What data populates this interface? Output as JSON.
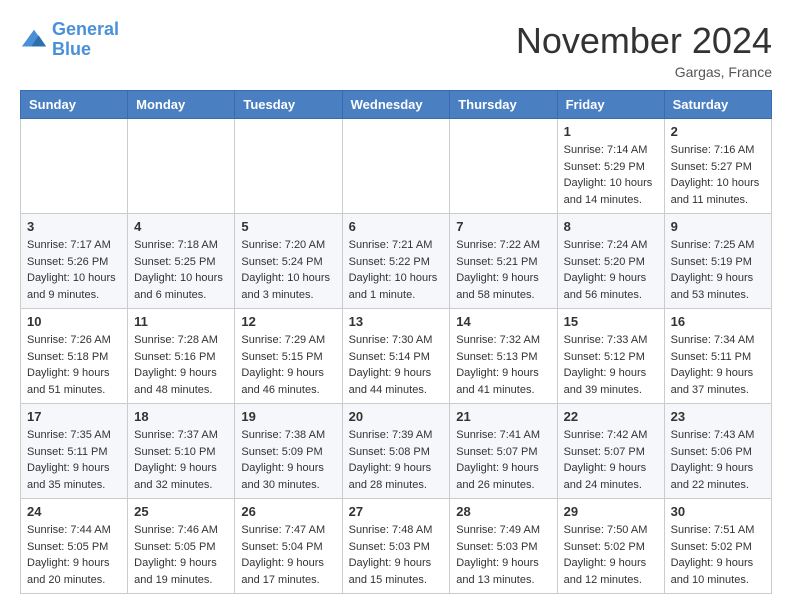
{
  "header": {
    "logo_line1": "General",
    "logo_line2": "Blue",
    "month": "November 2024",
    "location": "Gargas, France"
  },
  "weekdays": [
    "Sunday",
    "Monday",
    "Tuesday",
    "Wednesday",
    "Thursday",
    "Friday",
    "Saturday"
  ],
  "weeks": [
    [
      {
        "day": "",
        "info": ""
      },
      {
        "day": "",
        "info": ""
      },
      {
        "day": "",
        "info": ""
      },
      {
        "day": "",
        "info": ""
      },
      {
        "day": "",
        "info": ""
      },
      {
        "day": "1",
        "info": "Sunrise: 7:14 AM\nSunset: 5:29 PM\nDaylight: 10 hours and 14 minutes."
      },
      {
        "day": "2",
        "info": "Sunrise: 7:16 AM\nSunset: 5:27 PM\nDaylight: 10 hours and 11 minutes."
      }
    ],
    [
      {
        "day": "3",
        "info": "Sunrise: 7:17 AM\nSunset: 5:26 PM\nDaylight: 10 hours and 9 minutes."
      },
      {
        "day": "4",
        "info": "Sunrise: 7:18 AM\nSunset: 5:25 PM\nDaylight: 10 hours and 6 minutes."
      },
      {
        "day": "5",
        "info": "Sunrise: 7:20 AM\nSunset: 5:24 PM\nDaylight: 10 hours and 3 minutes."
      },
      {
        "day": "6",
        "info": "Sunrise: 7:21 AM\nSunset: 5:22 PM\nDaylight: 10 hours and 1 minute."
      },
      {
        "day": "7",
        "info": "Sunrise: 7:22 AM\nSunset: 5:21 PM\nDaylight: 9 hours and 58 minutes."
      },
      {
        "day": "8",
        "info": "Sunrise: 7:24 AM\nSunset: 5:20 PM\nDaylight: 9 hours and 56 minutes."
      },
      {
        "day": "9",
        "info": "Sunrise: 7:25 AM\nSunset: 5:19 PM\nDaylight: 9 hours and 53 minutes."
      }
    ],
    [
      {
        "day": "10",
        "info": "Sunrise: 7:26 AM\nSunset: 5:18 PM\nDaylight: 9 hours and 51 minutes."
      },
      {
        "day": "11",
        "info": "Sunrise: 7:28 AM\nSunset: 5:16 PM\nDaylight: 9 hours and 48 minutes."
      },
      {
        "day": "12",
        "info": "Sunrise: 7:29 AM\nSunset: 5:15 PM\nDaylight: 9 hours and 46 minutes."
      },
      {
        "day": "13",
        "info": "Sunrise: 7:30 AM\nSunset: 5:14 PM\nDaylight: 9 hours and 44 minutes."
      },
      {
        "day": "14",
        "info": "Sunrise: 7:32 AM\nSunset: 5:13 PM\nDaylight: 9 hours and 41 minutes."
      },
      {
        "day": "15",
        "info": "Sunrise: 7:33 AM\nSunset: 5:12 PM\nDaylight: 9 hours and 39 minutes."
      },
      {
        "day": "16",
        "info": "Sunrise: 7:34 AM\nSunset: 5:11 PM\nDaylight: 9 hours and 37 minutes."
      }
    ],
    [
      {
        "day": "17",
        "info": "Sunrise: 7:35 AM\nSunset: 5:11 PM\nDaylight: 9 hours and 35 minutes."
      },
      {
        "day": "18",
        "info": "Sunrise: 7:37 AM\nSunset: 5:10 PM\nDaylight: 9 hours and 32 minutes."
      },
      {
        "day": "19",
        "info": "Sunrise: 7:38 AM\nSunset: 5:09 PM\nDaylight: 9 hours and 30 minutes."
      },
      {
        "day": "20",
        "info": "Sunrise: 7:39 AM\nSunset: 5:08 PM\nDaylight: 9 hours and 28 minutes."
      },
      {
        "day": "21",
        "info": "Sunrise: 7:41 AM\nSunset: 5:07 PM\nDaylight: 9 hours and 26 minutes."
      },
      {
        "day": "22",
        "info": "Sunrise: 7:42 AM\nSunset: 5:07 PM\nDaylight: 9 hours and 24 minutes."
      },
      {
        "day": "23",
        "info": "Sunrise: 7:43 AM\nSunset: 5:06 PM\nDaylight: 9 hours and 22 minutes."
      }
    ],
    [
      {
        "day": "24",
        "info": "Sunrise: 7:44 AM\nSunset: 5:05 PM\nDaylight: 9 hours and 20 minutes."
      },
      {
        "day": "25",
        "info": "Sunrise: 7:46 AM\nSunset: 5:05 PM\nDaylight: 9 hours and 19 minutes."
      },
      {
        "day": "26",
        "info": "Sunrise: 7:47 AM\nSunset: 5:04 PM\nDaylight: 9 hours and 17 minutes."
      },
      {
        "day": "27",
        "info": "Sunrise: 7:48 AM\nSunset: 5:03 PM\nDaylight: 9 hours and 15 minutes."
      },
      {
        "day": "28",
        "info": "Sunrise: 7:49 AM\nSunset: 5:03 PM\nDaylight: 9 hours and 13 minutes."
      },
      {
        "day": "29",
        "info": "Sunrise: 7:50 AM\nSunset: 5:02 PM\nDaylight: 9 hours and 12 minutes."
      },
      {
        "day": "30",
        "info": "Sunrise: 7:51 AM\nSunset: 5:02 PM\nDaylight: 9 hours and 10 minutes."
      }
    ]
  ]
}
